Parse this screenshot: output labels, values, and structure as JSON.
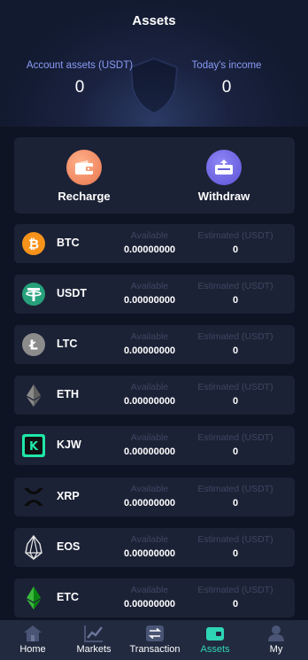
{
  "header": {
    "title": "Assets",
    "account_assets_label": "Account assets  (USDT)",
    "account_assets_value": "0",
    "todays_income_label": "Today's income",
    "todays_income_value": "0"
  },
  "actions": {
    "recharge_label": "Recharge",
    "withdraw_label": "Withdraw"
  },
  "columns": {
    "available_label": "Available",
    "estimated_label": "Estimated  (USDT)"
  },
  "coins": [
    {
      "name": "BTC",
      "icon": "btc-icon",
      "available": "0.00000000",
      "estimated": "0"
    },
    {
      "name": "USDT",
      "icon": "usdt-icon",
      "available": "0.00000000",
      "estimated": "0"
    },
    {
      "name": "LTC",
      "icon": "ltc-icon",
      "available": "0.00000000",
      "estimated": "0"
    },
    {
      "name": "ETH",
      "icon": "eth-icon",
      "available": "0.00000000",
      "estimated": "0"
    },
    {
      "name": "KJW",
      "icon": "kjw-icon",
      "available": "0.00000000",
      "estimated": "0"
    },
    {
      "name": "XRP",
      "icon": "xrp-icon",
      "available": "0.00000000",
      "estimated": "0"
    },
    {
      "name": "EOS",
      "icon": "eos-icon",
      "available": "0.00000000",
      "estimated": "0"
    },
    {
      "name": "ETC",
      "icon": "etc-icon",
      "available": "0.00000000",
      "estimated": "0"
    }
  ],
  "tabs": [
    {
      "label": "Home",
      "icon": "home-icon"
    },
    {
      "label": "Markets",
      "icon": "chart-icon"
    },
    {
      "label": "Transaction",
      "icon": "exchange-icon"
    },
    {
      "label": "Assets",
      "icon": "wallet-icon",
      "active": true
    },
    {
      "label": "My",
      "icon": "user-icon"
    }
  ],
  "colors": {
    "background": "#0f1424",
    "card": "#1c2236",
    "accent_label": "#8a9cf5",
    "active_tab": "#2fd6b5"
  }
}
